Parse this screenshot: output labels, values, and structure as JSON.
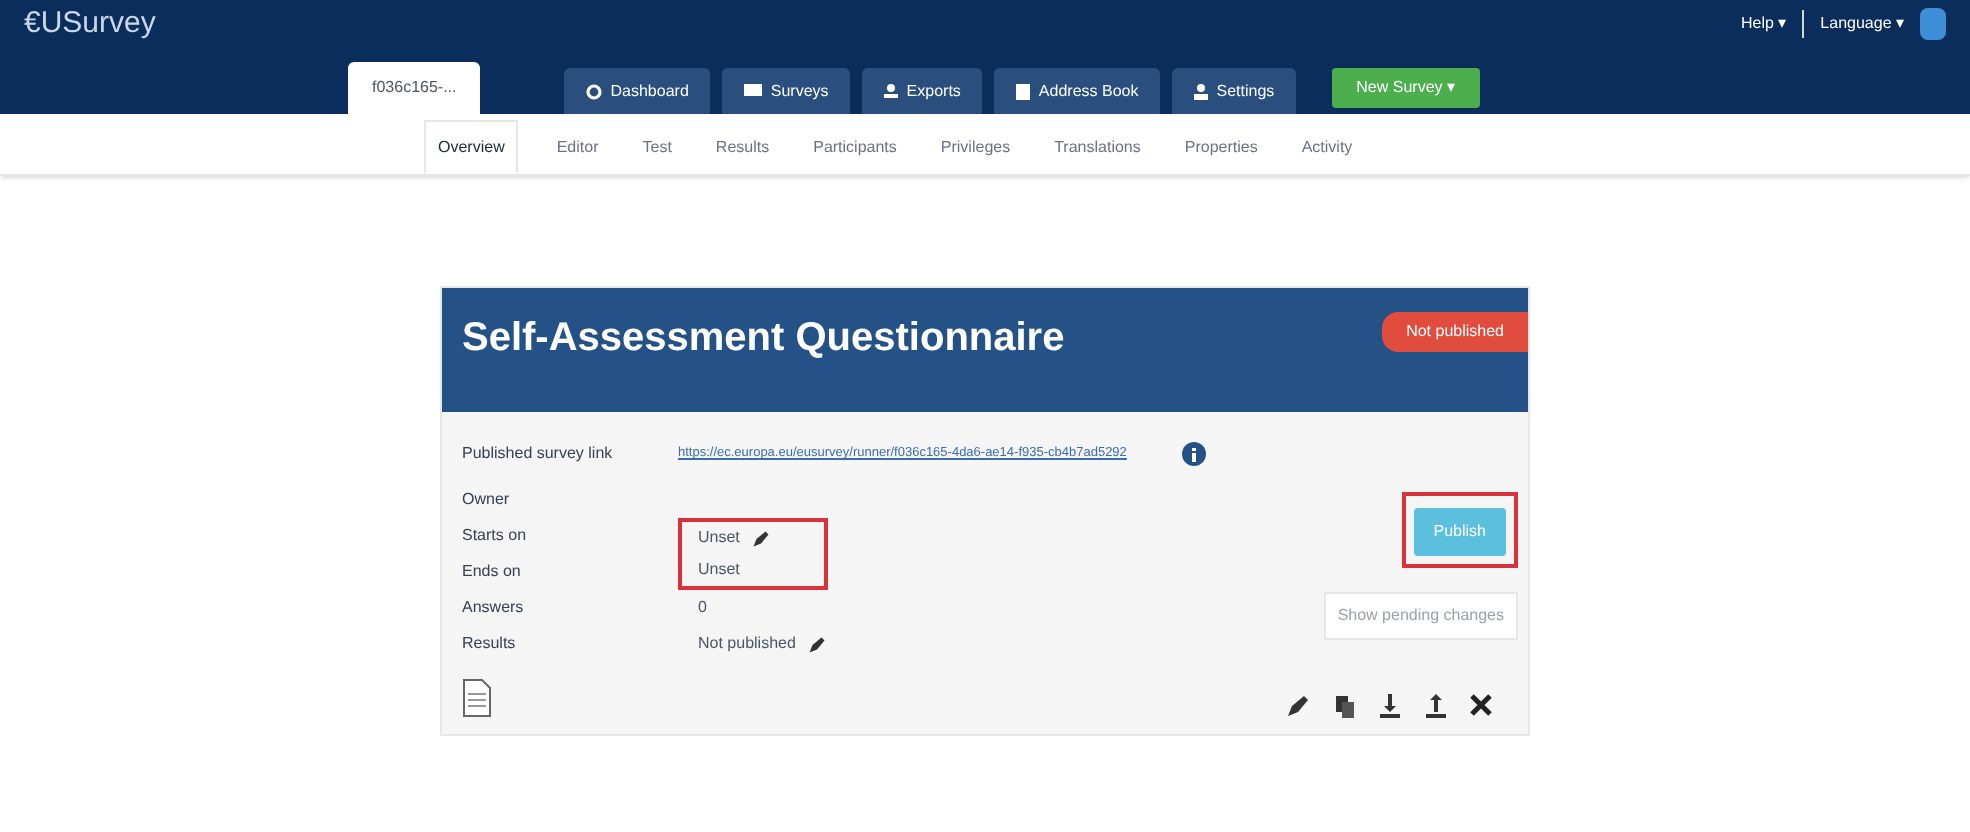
{
  "brand": "€USurvey",
  "top_links": [
    {
      "label": "Help ▾"
    },
    {
      "label": "Language ▾"
    }
  ],
  "main_tabs": [
    {
      "label": "f036c165-...",
      "kind": "survey",
      "selected": true
    },
    {
      "label": "Dashboard",
      "kind": "dashboard",
      "selected": false
    },
    {
      "label": "Surveys",
      "kind": "surveys",
      "selected": false
    },
    {
      "label": "Exports",
      "kind": "exports",
      "selected": false
    },
    {
      "label": "Address Book",
      "kind": "book",
      "selected": false
    },
    {
      "label": "Settings",
      "kind": "settings",
      "selected": false
    }
  ],
  "new_survey_button": "New Survey ▾",
  "sub_tabs": [
    {
      "label": "Overview",
      "selected": true
    },
    {
      "label": "Editor",
      "selected": false
    },
    {
      "label": "Test",
      "selected": false
    },
    {
      "label": "Results",
      "selected": false
    },
    {
      "label": "Participants",
      "selected": false
    },
    {
      "label": "Privileges",
      "selected": false
    },
    {
      "label": "Translations",
      "selected": false
    },
    {
      "label": "Properties",
      "selected": false
    },
    {
      "label": "Activity",
      "selected": false
    }
  ],
  "survey": {
    "title": "Self-Assessment Questionnaire",
    "status_badge": "Not published",
    "link_label": "Published survey link",
    "link": "https://ec.europa.eu/eusurvey/runner/f036c165-4da6-ae14-f935-cb4b7ad5292",
    "fields": [
      {
        "label": "Owner",
        "editable": false,
        "highlighted": false
      },
      {
        "label": "Starts on",
        "value": "Unset",
        "editable": true,
        "highlighted": true
      },
      {
        "label": "Ends on",
        "value": "Unset",
        "editable": false,
        "highlighted": true
      },
      {
        "label": "Answers",
        "value": "0",
        "editable": false,
        "highlighted": false
      },
      {
        "label": "Results",
        "value": "Not published",
        "editable": true,
        "highlighted": false
      }
    ],
    "publish_button": {
      "label": "Publish",
      "highlighted": true
    },
    "pending_button": {
      "label": "Show pending changes",
      "disabled": true
    }
  }
}
